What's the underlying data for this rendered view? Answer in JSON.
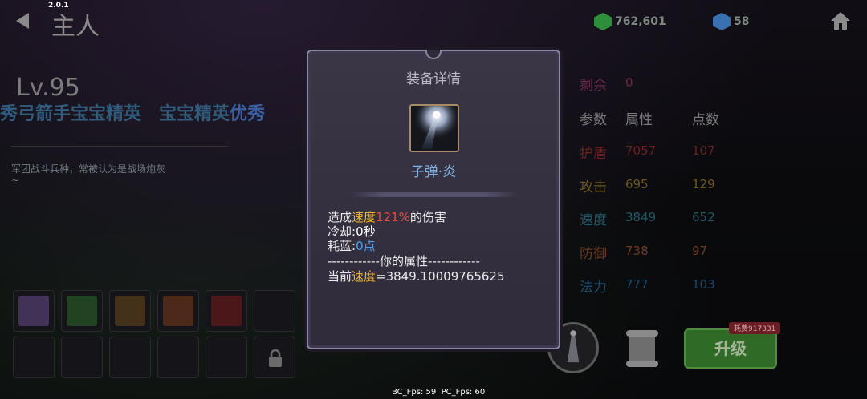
{
  "app": {
    "version": "2.0.1",
    "title": "主人"
  },
  "resources": {
    "gold": "762,601",
    "gems": "58"
  },
  "hero": {
    "level": "Lv.95",
    "rank_left": "秀弓箭手宝宝精英",
    "rank_right_prefix": "宝宝精英",
    "rank_right_highlight": "优秀",
    "description": "军团战斗兵种，常被认为是战场炮灰",
    "description_tail": "~"
  },
  "stats": {
    "remaining_label": "剩余",
    "remaining_value": "0",
    "headers": [
      "参数",
      "属性",
      "点数"
    ],
    "rows": [
      {
        "name": "护盾",
        "value": "7057",
        "points": "107",
        "color": "#6b2020"
      },
      {
        "name": "攻击",
        "value": "695",
        "points": "129",
        "color": "#6b5a1a"
      },
      {
        "name": "速度",
        "value": "3849",
        "points": "652",
        "color": "#1e5a66"
      },
      {
        "name": "防御",
        "value": "738",
        "points": "97",
        "color": "#6b3a20"
      },
      {
        "name": "法力",
        "value": "777",
        "points": "103",
        "color": "#1c4a6b"
      }
    ]
  },
  "actions": {
    "upgrade_label": "升级",
    "cost_label": "耗费917331"
  },
  "fps": {
    "bc": "BC_Fps: 59",
    "pc": "PC_Fps: 60"
  },
  "modal": {
    "title": "装备详情",
    "item_name": "子弹·炎",
    "line1_prefix": "造成",
    "line1_stat": "速度",
    "line1_percent": "121%",
    "line1_suffix": "的伤害",
    "cooldown_label": "冷却:",
    "cooldown_value": "0秒",
    "mana_label": "耗蓝:",
    "mana_value": "0点",
    "section_label": "------------你的属性------------",
    "current_prefix": "当前",
    "current_stat": "速度",
    "current_value": "=3849.10009765625"
  },
  "colors": {
    "accent_yellow": "#f0b52a",
    "accent_red": "#e84b3a",
    "accent_blue": "#4aa3f0",
    "item_name": "#7fb3e8"
  }
}
